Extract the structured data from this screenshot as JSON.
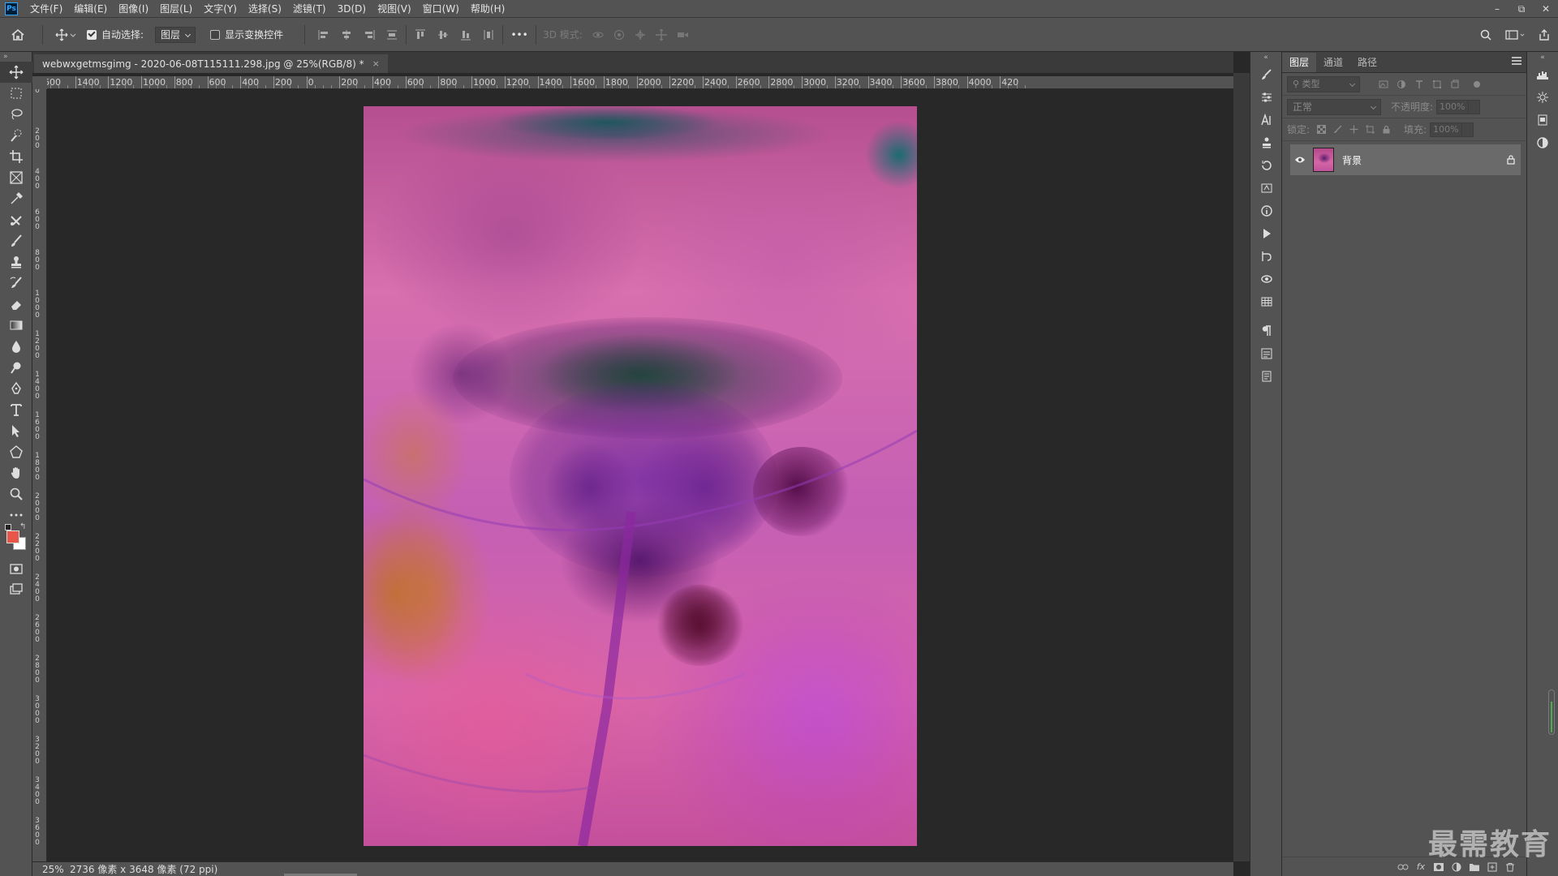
{
  "app": {
    "logo": "Ps"
  },
  "menu": [
    "文件(F)",
    "编辑(E)",
    "图像(I)",
    "图层(L)",
    "文字(Y)",
    "选择(S)",
    "滤镜(T)",
    "3D(D)",
    "视图(V)",
    "窗口(W)",
    "帮助(H)"
  ],
  "window_controls": {
    "minimize": "–",
    "restore": "⧉",
    "close": "✕"
  },
  "options": {
    "auto_select_label": "自动选择:",
    "auto_select_checked": true,
    "auto_select_target": "图层",
    "show_transform_label": "显示变换控件",
    "show_transform_checked": false,
    "more": "•••",
    "mode_3d_label": "3D 模式:"
  },
  "document": {
    "tab_title": "webwxgetmsgimg - 2020-06-08T115111.298.jpg @ 25%(RGB/8) *",
    "close": "×"
  },
  "ruler": {
    "h_labels": [
      "600",
      "1400",
      "1200",
      "1000",
      "800",
      "600",
      "400",
      "200",
      "0",
      "200",
      "400",
      "600",
      "800",
      "1000",
      "1200",
      "1400",
      "1600",
      "1800",
      "2000",
      "2200",
      "2400",
      "2600",
      "2800",
      "3000",
      "3200",
      "3400",
      "3600",
      "3800",
      "4000",
      "420"
    ],
    "v_labels": [
      "0",
      "2 0 0",
      "4 0 0",
      "6 0 0",
      "8 0 0",
      "1 0 0 0",
      "1 2 0 0",
      "1 4 0 0",
      "1 6 0 0",
      "1 8 0 0",
      "2 0 0 0",
      "2 2 0 0",
      "2 4 0 0",
      "2 6 0 0",
      "2 8 0 0",
      "3 0 0 0",
      "3 2 0 0",
      "3 4 0 0",
      "3 6 0 0"
    ]
  },
  "status": {
    "zoom": "25%",
    "info": "2736 像素 x 3648 像素 (72 ppi)"
  },
  "colors": {
    "foreground": "#e8564a",
    "background": "#ffffff",
    "accent": "#31a8ff"
  },
  "layers_panel": {
    "tabs": [
      "图层",
      "通道",
      "路径"
    ],
    "active_tab": 0,
    "filter_placeholder": "类型",
    "blend_mode": "正常",
    "opacity_label": "不透明度:",
    "opacity_value": "100%",
    "lock_label": "锁定:",
    "fill_label": "填充:",
    "fill_value": "100%",
    "layers": [
      {
        "name": "背景",
        "visible": true,
        "locked": true
      }
    ]
  },
  "watermark": "最需教育"
}
